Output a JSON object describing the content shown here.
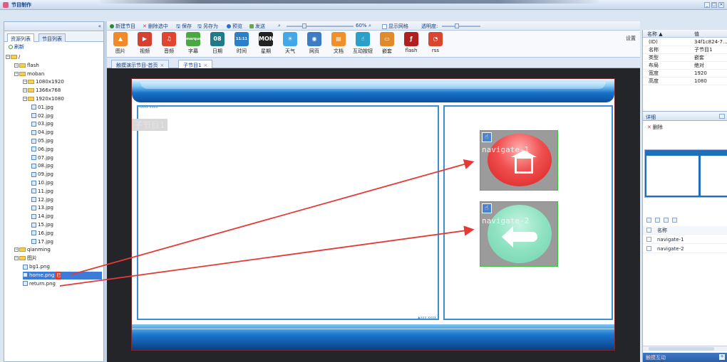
{
  "window": {
    "title": "节目制作",
    "buttons": [
      "_",
      "□",
      "×"
    ]
  },
  "left_panel": {
    "tabs": [
      "资源列表",
      "节目列表"
    ],
    "refresh_label": "刷新",
    "tree": [
      {
        "label": "/",
        "indent": 0,
        "type": "folder"
      },
      {
        "label": "flash",
        "indent": 1,
        "type": "folder"
      },
      {
        "label": "moban",
        "indent": 1,
        "type": "folder"
      },
      {
        "label": "1080x1920",
        "indent": 2,
        "type": "folder"
      },
      {
        "label": "1366x768",
        "indent": 2,
        "type": "folder"
      },
      {
        "label": "1920x1080",
        "indent": 2,
        "type": "folder"
      },
      {
        "label": "01.jpg",
        "indent": 3,
        "type": "file"
      },
      {
        "label": "02.jpg",
        "indent": 3,
        "type": "file"
      },
      {
        "label": "03.jpg",
        "indent": 3,
        "type": "file"
      },
      {
        "label": "04.jpg",
        "indent": 3,
        "type": "file"
      },
      {
        "label": "05.jpg",
        "indent": 3,
        "type": "file"
      },
      {
        "label": "06.jpg",
        "indent": 3,
        "type": "file"
      },
      {
        "label": "07.jpg",
        "indent": 3,
        "type": "file"
      },
      {
        "label": "08.jpg",
        "indent": 3,
        "type": "file"
      },
      {
        "label": "09.jpg",
        "indent": 3,
        "type": "file"
      },
      {
        "label": "10.jpg",
        "indent": 3,
        "type": "file"
      },
      {
        "label": "11.jpg",
        "indent": 3,
        "type": "file"
      },
      {
        "label": "12.jpg",
        "indent": 3,
        "type": "file"
      },
      {
        "label": "13.jpg",
        "indent": 3,
        "type": "file"
      },
      {
        "label": "14.jpg",
        "indent": 3,
        "type": "file"
      },
      {
        "label": "15.jpg",
        "indent": 3,
        "type": "file"
      },
      {
        "label": "16.jpg",
        "indent": 3,
        "type": "file"
      },
      {
        "label": "17.jpg",
        "indent": 3,
        "type": "file"
      },
      {
        "label": "qianming",
        "indent": 1,
        "type": "folder"
      },
      {
        "label": "图片",
        "indent": 1,
        "type": "folder"
      },
      {
        "label": "bg1.png",
        "indent": 2,
        "type": "file"
      },
      {
        "label": "home.png",
        "indent": 2,
        "type": "file",
        "selected": true,
        "badge": "已"
      },
      {
        "label": "return.png",
        "indent": 2,
        "type": "file"
      }
    ]
  },
  "toolbar": {
    "new_program": "新建节目",
    "delete_selected": "删除选中",
    "save": "保存",
    "save_as": "另存为",
    "preview": "预览",
    "send": "发送",
    "zoom": "60%",
    "show_grid": "显示网格",
    "opacity": "透明度:",
    "colors": {
      "new": "#2a8a2a",
      "delete": "#d33",
      "save": "#2a5ea8",
      "preview": "#2a6fd0",
      "send": "#2a8a2a"
    }
  },
  "tools": [
    {
      "label": "图片",
      "icon": "image-icon",
      "glyph": "▲",
      "color": "#f08a2a"
    },
    {
      "label": "视频",
      "icon": "video-icon",
      "glyph": "▶",
      "color": "#d6412f"
    },
    {
      "label": "音频",
      "icon": "audio-icon",
      "glyph": "♫",
      "color": "#e2452f"
    },
    {
      "label": "字幕",
      "icon": "marquee-icon",
      "glyph": "marquee",
      "color": "#4aa840"
    },
    {
      "label": "日期",
      "icon": "date-icon",
      "glyph": "08",
      "color": "#1f7a8a"
    },
    {
      "label": "时间",
      "icon": "clock-icon",
      "glyph": "11:11",
      "color": "#2a7fc8"
    },
    {
      "label": "星期",
      "icon": "weekday-icon",
      "glyph": "MON",
      "color": "#222222"
    },
    {
      "label": "天气",
      "icon": "weather-icon",
      "glyph": "☀",
      "color": "#43a8e8"
    },
    {
      "label": "网页",
      "icon": "web-icon",
      "glyph": "◉",
      "color": "#3b7cc2"
    },
    {
      "label": "文档",
      "icon": "document-icon",
      "glyph": "▤",
      "color": "#f0902a"
    },
    {
      "label": "互动按钮",
      "icon": "touch-button-icon",
      "glyph": "☝",
      "color": "#2aa0c8"
    },
    {
      "label": "嵌套",
      "icon": "nest-icon",
      "glyph": "▭",
      "color": "#e08a2a"
    },
    {
      "label": "flash",
      "icon": "flash-icon",
      "glyph": "ƒ",
      "color": "#b02020"
    },
    {
      "label": "rss",
      "icon": "rss-icon",
      "glyph": "◔",
      "color": "#d9452f"
    }
  ],
  "settings_label": "设置",
  "doc_tabs": [
    {
      "label": "触摸演示节目-首页",
      "active": false
    },
    {
      "label": "子节目1",
      "active": true
    }
  ],
  "stage": {
    "sub_label": "子节目1",
    "nav1": "navigate-1",
    "nav2": "navigate-2",
    "left_tag": "hxxx xxxx",
    "right_tag": "▲xxx xxxx"
  },
  "properties": {
    "header_name": "名称",
    "header_value": "值",
    "rows": [
      {
        "k": "(ID)",
        "v": "34f1c824-7..."
      },
      {
        "k": "名称",
        "v": "子节目1"
      },
      {
        "k": "类型",
        "v": "嵌套"
      },
      {
        "k": "布局",
        "v": "绝对"
      },
      {
        "k": "宽度",
        "v": "1920"
      },
      {
        "k": "高度",
        "v": "1080"
      }
    ]
  },
  "detail": {
    "title": "详细",
    "delete_label": "删除",
    "list_header": "名称",
    "items": [
      "navigate-1",
      "navigate-2"
    ]
  },
  "touch_bar_label": "触摸互动"
}
